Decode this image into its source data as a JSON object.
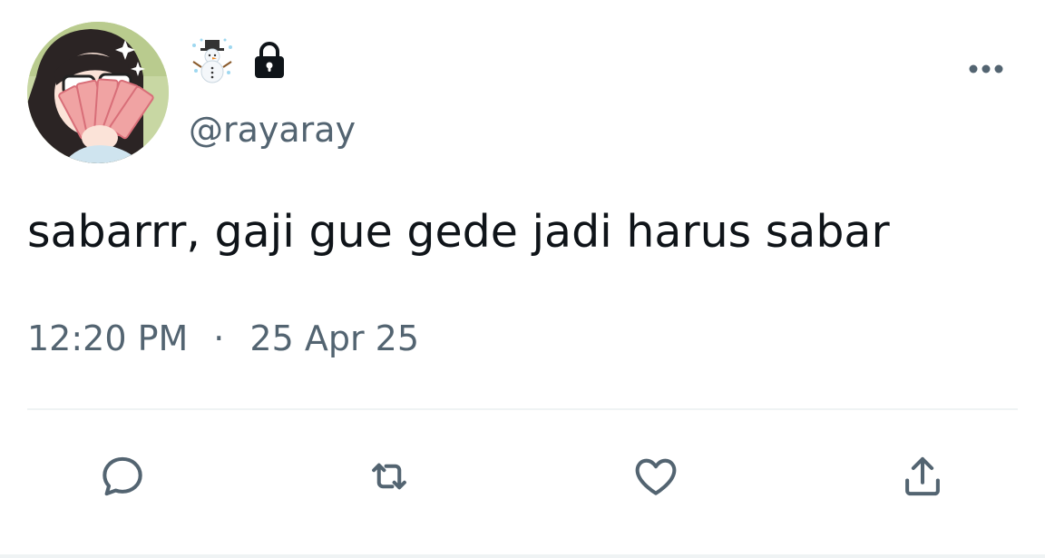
{
  "tweet": {
    "handle": "@rayaray",
    "text": "sabarrr, gaji gue gede jadi harus sabar",
    "time": "12:20 PM",
    "separator": "·",
    "date": "25 Apr 25"
  },
  "icons": {
    "name_emoji": "snowman-icon",
    "protected": "lock-icon",
    "more": "more-icon",
    "reply": "reply-icon",
    "retweet": "retweet-icon",
    "like": "heart-icon",
    "share": "share-icon"
  },
  "colors": {
    "text": "#0f1419",
    "secondary": "#536471",
    "divider": "#eff3f4"
  }
}
